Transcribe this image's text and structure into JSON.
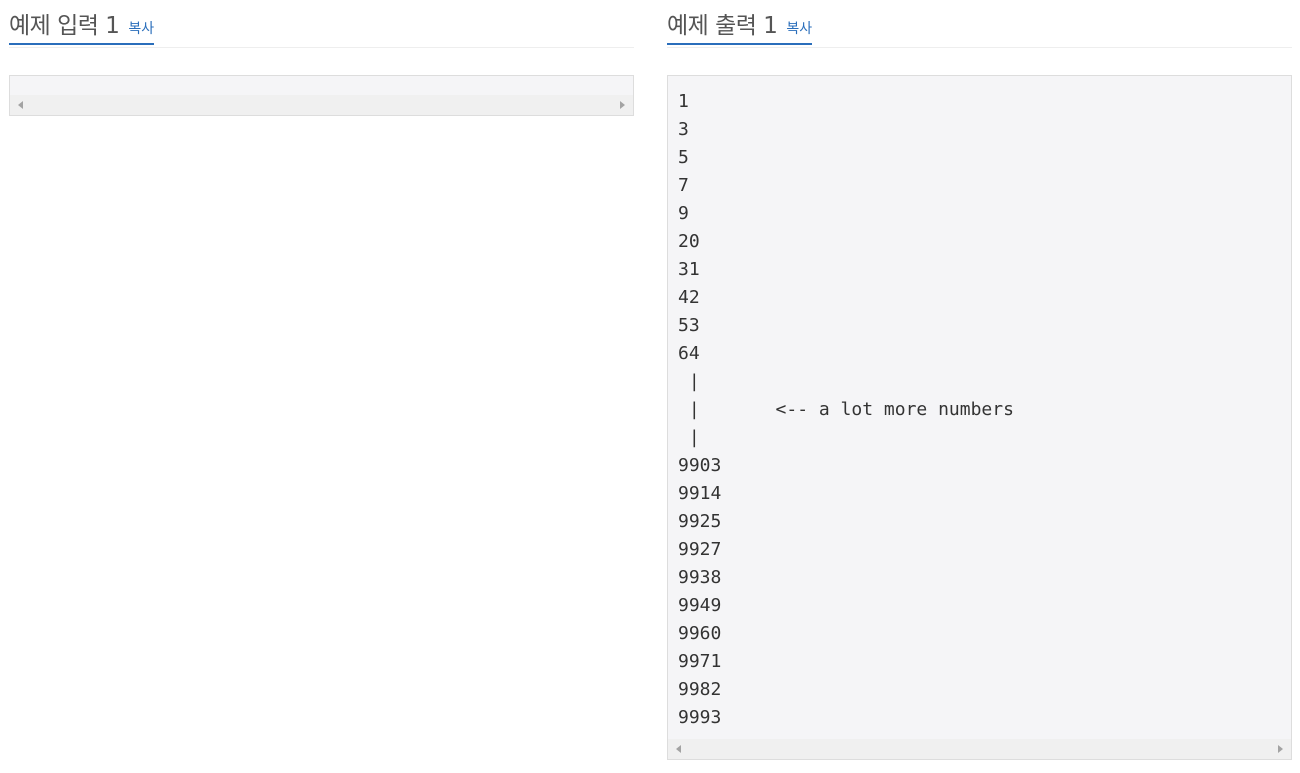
{
  "input_panel": {
    "title": "예제 입력 1",
    "copy_label": "복사",
    "content": ""
  },
  "output_panel": {
    "title": "예제 출력 1",
    "copy_label": "복사",
    "content": "1\n3\n5\n7\n9\n20\n31\n42\n53\n64\n |\n |       <-- a lot more numbers\n |\n9903\n9914\n9925\n9927\n9938\n9949\n9960\n9971\n9982\n9993"
  },
  "colors": {
    "accent": "#2a6ebb",
    "sample_background": "#f5f5f7",
    "border": "#dddddd"
  },
  "icons": {
    "scroll_left": "triangle-left-icon",
    "scroll_right": "triangle-right-icon"
  }
}
